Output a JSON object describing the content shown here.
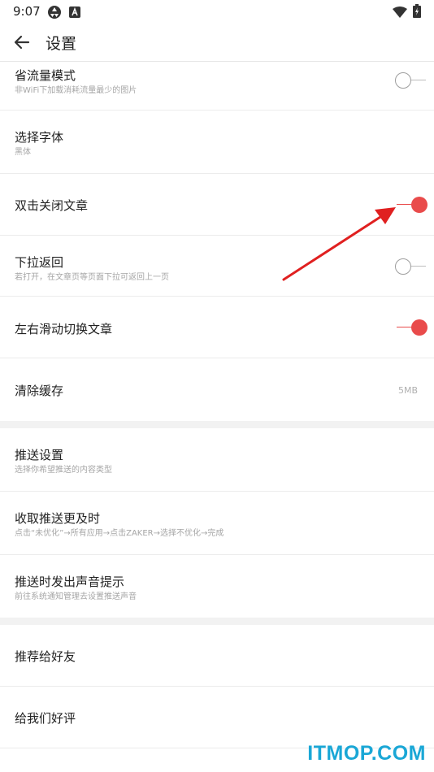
{
  "status_bar": {
    "time": "9:07",
    "icons": [
      "settings-wheel-icon",
      "a-box-icon",
      "wifi-icon",
      "battery-charging-icon"
    ]
  },
  "header": {
    "title": "设置",
    "back_icon": "arrow-left-icon"
  },
  "colors": {
    "accent": "#e94b4b",
    "divider": "#ececec",
    "section_gap": "#f2f2f2",
    "watermark": "#1aa7d6"
  },
  "settings": {
    "data_saver": {
      "title": "省流量模式",
      "subtitle": "非WiFi下加载消耗流量最少的图片",
      "enabled": false
    },
    "font": {
      "title": "选择字体",
      "subtitle": "黑体"
    },
    "double_tap_close": {
      "title": "双击关闭文章",
      "enabled": true
    },
    "pull_back": {
      "title": "下拉返回",
      "subtitle": "若打开，在文章页等页面下拉可返回上一页",
      "enabled": false
    },
    "swipe_switch": {
      "title": "左右滑动切换文章",
      "enabled": true
    },
    "clear_cache": {
      "title": "清除缓存",
      "value": "5MB"
    }
  },
  "push": {
    "settings": {
      "title": "推送设置",
      "subtitle": "选择你希望推送的内容类型"
    },
    "timely": {
      "title": "收取推送更及时",
      "subtitle": "点击“未优化”→所有应用→点击ZAKER→选择不优化→完成"
    },
    "sound": {
      "title": "推送时发出声音提示",
      "subtitle": "前往系统通知管理去设置推送声音"
    }
  },
  "other": {
    "recommend": {
      "title": "推荐给好友"
    },
    "rate": {
      "title": "给我们好评"
    }
  },
  "watermark": "ITMOP.COM"
}
